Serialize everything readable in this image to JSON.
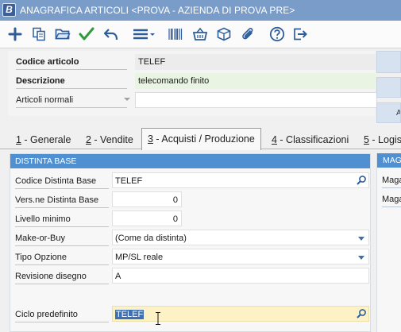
{
  "window": {
    "app_logo": "B",
    "title": "ANAGRAFICA ARTICOLI <PROVA - AZIENDA DI PROVA PRE>"
  },
  "toolbar": {
    "icons": [
      "plus-icon",
      "copy-icon",
      "folder-open-icon",
      "checkmark-icon",
      "undo-icon",
      "menu-icon",
      "barcode-icon",
      "basket-icon",
      "box-icon",
      "paperclip-icon",
      "help-icon",
      "exit-icon"
    ]
  },
  "header": {
    "codice_label": "Codice articolo",
    "codice_value": "TELEF",
    "descrizione_label": "Descrizione",
    "descrizione_value": "telecomando finito",
    "tipo_label": "Articoli normali",
    "tipo_value": "",
    "side_button_label": "Ar"
  },
  "tabs": [
    {
      "num": "1",
      "label": " - Generale"
    },
    {
      "num": "2",
      "label": " - Vendite"
    },
    {
      "num": "3",
      "label": " - Acquisti / Produzione"
    },
    {
      "num": "4",
      "label": " - Classificazioni"
    },
    {
      "num": "5",
      "label": " - Logis"
    }
  ],
  "distinta": {
    "title": "DISTINTA BASE",
    "fields": [
      {
        "label": "Codice Distinta Base",
        "value": "TELEF"
      },
      {
        "label": "Vers.ne Distinta Base",
        "value": "0"
      },
      {
        "label": "Livello minimo",
        "value": "0"
      },
      {
        "label": "Make-or-Buy",
        "value": "(Come da distinta)"
      },
      {
        "label": "Tipo Opzione",
        "value": "MP/SL reale"
      },
      {
        "label": "Revisione disegno",
        "value": "A"
      },
      {
        "label": "Ciclo predefinito",
        "value": "TELEF"
      }
    ]
  },
  "magazzino": {
    "title": "MAG",
    "labels": [
      "Maga",
      "Maga"
    ]
  },
  "colors": {
    "titlebar": "#7a9cc8",
    "section_header": "#4f90d2",
    "descr_highlight": "#e9f4e3",
    "field_highlight": "#fdf2c6",
    "selection": "#3e6fb2"
  }
}
